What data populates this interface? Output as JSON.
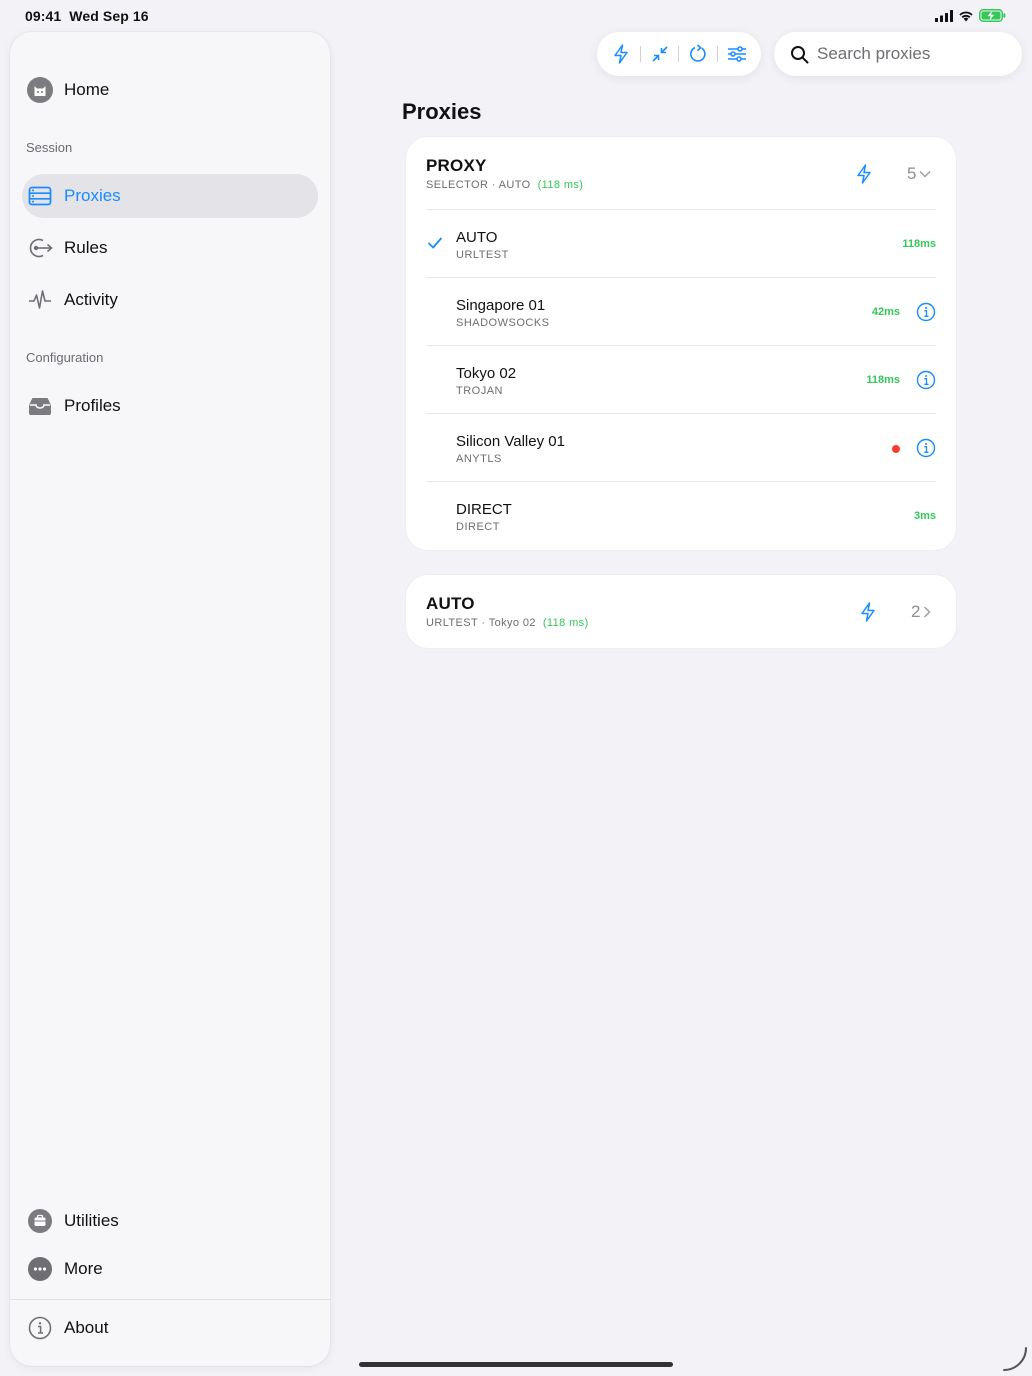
{
  "status_bar": {
    "time": "09:41",
    "date": "Wed Sep 16"
  },
  "sidebar": {
    "home": "Home",
    "session_label": "Session",
    "session_items": [
      {
        "label": "Proxies",
        "icon": "proxies-icon",
        "active": true
      },
      {
        "label": "Rules",
        "icon": "rules-icon"
      },
      {
        "label": "Activity",
        "icon": "activity-icon"
      }
    ],
    "configuration_label": "Configuration",
    "configuration_items": [
      {
        "label": "Profiles",
        "icon": "profiles-icon"
      }
    ],
    "bottom_items": [
      {
        "label": "Utilities",
        "icon": "utilities-icon"
      },
      {
        "label": "More",
        "icon": "more-icon"
      }
    ],
    "about": "About"
  },
  "toolbar": {
    "buttons": [
      "bolt-icon",
      "collapse-icon",
      "refresh-icon",
      "sliders-icon"
    ]
  },
  "search": {
    "placeholder": "Search proxies"
  },
  "main": {
    "title": "Proxies",
    "groups": [
      {
        "name": "PROXY",
        "type": "SELECTOR",
        "selected": "AUTO",
        "latency": "(118 ms)",
        "count": "5",
        "expanded": true,
        "proxies": [
          {
            "name": "AUTO",
            "type": "URLTEST",
            "latency": "118ms",
            "selected": true,
            "info": false
          },
          {
            "name": "Singapore 01",
            "type": "SHADOWSOCKS",
            "latency": "42ms",
            "info": true
          },
          {
            "name": "Tokyo 02",
            "type": "TROJAN",
            "latency": "118ms",
            "info": true
          },
          {
            "name": "Silicon Valley 01",
            "type": "ANYTLS",
            "latency": "",
            "status": "error",
            "info": true
          },
          {
            "name": "DIRECT",
            "type": "DIRECT",
            "latency": "3ms",
            "info": false
          }
        ]
      },
      {
        "name": "AUTO",
        "type": "URLTEST",
        "selected": "Tokyo 02",
        "latency": "(118 ms)",
        "count": "2",
        "expanded": false
      }
    ]
  },
  "colors": {
    "accent": "#1a8cff",
    "latency_good": "#34c759",
    "error": "#ff3b30",
    "background": "#f2f2f7"
  }
}
